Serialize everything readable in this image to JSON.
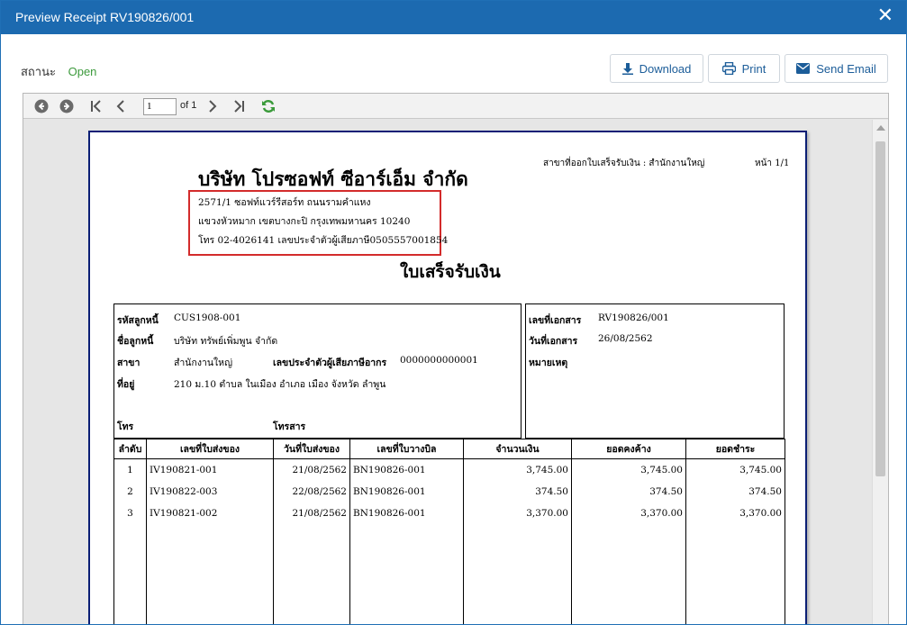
{
  "window": {
    "title": "Preview Receipt RV190826/001"
  },
  "status": {
    "label": "สถานะ",
    "value": "Open",
    "value_color": "#3c9a3c"
  },
  "actions": {
    "download": "Download",
    "print": "Print",
    "send_email": "Send Email"
  },
  "viewer_toolbar": {
    "page_current": "1",
    "page_of": "of 1"
  },
  "receipt": {
    "company": "บริษัท โปรซอฟท์ ซีอาร์เอ็ม จำกัด",
    "branch_issued": "สาขาที่ออกใบเสร็จรับเงิน : สำนักงานใหญ่",
    "page_label": "หน้า 1/1",
    "address_lines": [
      "2571/1 ซอฟท์แวร์รีสอร์ท ถนนรามคำแหง",
      "แขวงหัวหมาก เขตบางกะปิ กรุงเทพมหานคร 10240",
      "โทร 02-4026141 เลขประจำตัวผู้เสียภาษี0505557001854"
    ],
    "document_title": "ใบเสร็จรับเงิน",
    "customer": {
      "code_label": "รหัสลูกหนี้",
      "code": "CUS1908-001",
      "name_label": "ชื่อลูกหนี้",
      "name": "บริษัท ทรัพย์เพิ่มพูน จำกัด",
      "branch_label": "สาขา",
      "branch": "สำนักงานใหญ่",
      "taxid_label": "เลขประจำตัวผู้เสียภาษีอากร",
      "taxid": "0000000000001",
      "address_label": "ที่อยู่",
      "address": "210 ม.10 ตำบล ในเมือง อำเภอ เมือง จังหวัด ลำพูน",
      "phone_label": "โทร",
      "fax_label": "โทรสาร"
    },
    "document": {
      "docno_label": "เลขที่เอกสาร",
      "docno": "RV190826/001",
      "date_label": "วันที่เอกสาร",
      "date": "26/08/2562",
      "remark_label": "หมายเหตุ"
    },
    "table": {
      "headers": [
        "ลำดับ",
        "เลขที่ใบส่งของ",
        "วันที่ใบส่งของ",
        "เลขที่ใบวางบิล",
        "จำนวนเงิน",
        "ยอดคงค้าง",
        "ยอดชำระ"
      ],
      "rows": [
        [
          "1",
          "IV190821-001",
          "21/08/2562",
          "BN190826-001",
          "3,745.00",
          "3,745.00",
          "3,745.00"
        ],
        [
          "2",
          "IV190822-003",
          "22/08/2562",
          "BN190826-001",
          "374.50",
          "374.50",
          "374.50"
        ],
        [
          "3",
          "IV190821-002",
          "21/08/2562",
          "BN190826-001",
          "3,370.00",
          "3,370.00",
          "3,370.00"
        ]
      ]
    }
  }
}
